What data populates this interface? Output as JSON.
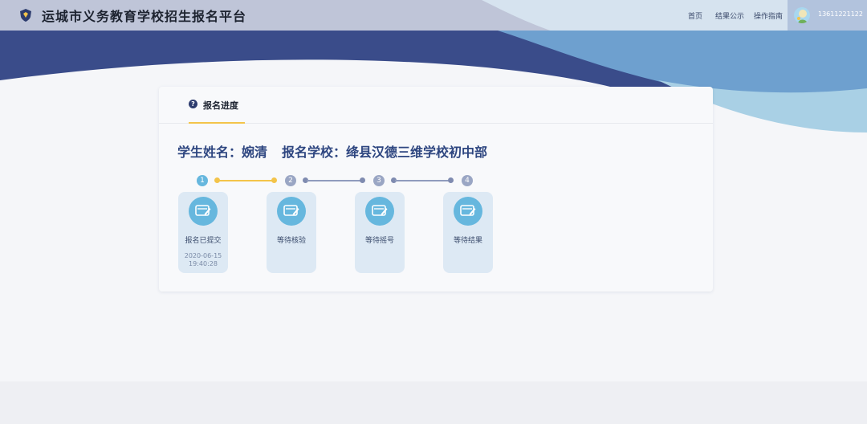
{
  "header": {
    "title": "运城市义务教育学校招生报名平台",
    "nav": [
      "首页",
      "结果公示",
      "操作指南"
    ],
    "username": "13611221122"
  },
  "card": {
    "tab_label": "报名进度",
    "student_label": "学生姓名：",
    "student_name": "婉清",
    "school_label": "报名学校：",
    "school_name": "绛县汉德三维学校初中部"
  },
  "steps": [
    {
      "num": "1",
      "label": "报名已提交",
      "date": "2020-06-15",
      "time": "19:40:28"
    },
    {
      "num": "2",
      "label": "等待核验"
    },
    {
      "num": "3",
      "label": "等待摇号"
    },
    {
      "num": "4",
      "label": "等待结果"
    }
  ],
  "colors": {
    "header_navy": "#3a4c8a",
    "accent_yellow": "#f3c44a",
    "step_active": "#66b7de",
    "step_pending": "#9aa6c4",
    "title_blue": "#2e4680"
  },
  "icons": {
    "logo": "shield-icon",
    "tab": "question-circle-icon",
    "step": "edit-card-icon"
  }
}
